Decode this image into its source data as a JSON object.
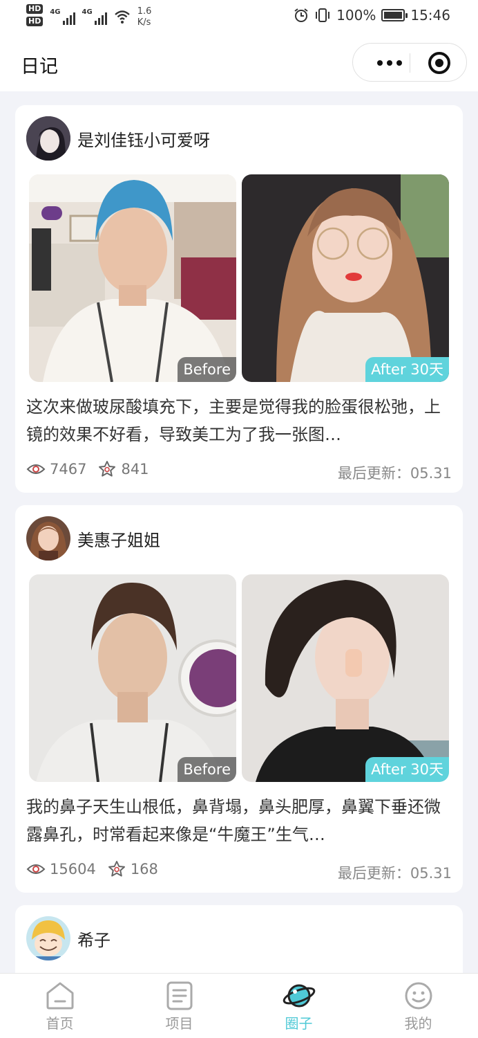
{
  "status_bar": {
    "hd1": "HD",
    "hd2": "HD",
    "sig1": "4G",
    "sig2": "4G",
    "speed_value": "1.6",
    "speed_unit": "K/s",
    "battery": "100%",
    "time": "15:46"
  },
  "nav": {
    "title": "日记"
  },
  "posts": [
    {
      "username": "是刘佳钰小可爱呀",
      "before_label": "Before",
      "after_label": "After 30天",
      "text": "这次来做玻尿酸填充下，主要是觉得我的脸蛋很松弛，上镜的效果不好看，导致美工为了我一张图…",
      "views": "7467",
      "likes": "841",
      "updated": "最后更新：05.31"
    },
    {
      "username": "美惠子姐姐",
      "before_label": "Before",
      "after_label": "After 30天",
      "text": "我的鼻子天生山根低，鼻背塌，鼻头肥厚，鼻翼下垂还微露鼻孔，时常看起来像是“牛魔王”生气…",
      "views": "15604",
      "likes": "168",
      "updated": "最后更新：05.31"
    },
    {
      "username": "希子"
    }
  ],
  "tabs": [
    {
      "label": "首页",
      "icon": "home-icon"
    },
    {
      "label": "项目",
      "icon": "document-icon"
    },
    {
      "label": "圈子",
      "icon": "planet-icon",
      "active": true
    },
    {
      "label": "我的",
      "icon": "smiley-icon"
    }
  ],
  "colors": {
    "accent": "#4fc9d6",
    "after_tag": "#5fd3dc",
    "background": "#f2f3f8"
  }
}
